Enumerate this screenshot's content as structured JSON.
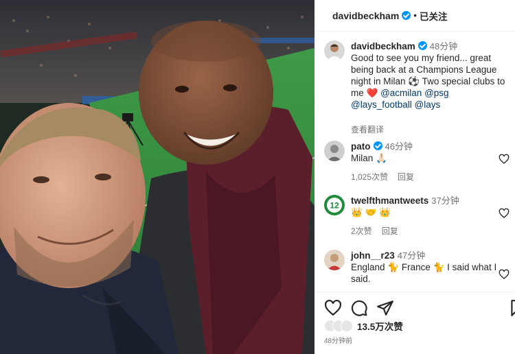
{
  "photo": {
    "alt_icon": "photo-image",
    "colors": {
      "crowd": "#3b3f47",
      "pitch": "#2f8a3e",
      "coat": "#2b2d31",
      "hoodie": "#5a1f2a"
    }
  },
  "header": {
    "username": "davidbeckham",
    "separator": "•",
    "follow_label": "已关注"
  },
  "caption": {
    "username": "davidbeckham",
    "time": "48分钟",
    "text_before": "Good to see you my friend... great being back at a Champions League night in Milan",
    "emoji_ball": "⚽",
    "text_middle": " Two special clubs to me ",
    "emoji_heart": "❤️",
    "tag1": "@acmilan",
    "tag2": "@psg",
    "tag3": "@lays_football",
    "tag4": "@lays",
    "translate": "查看翻译"
  },
  "comments": [
    {
      "username": "pato",
      "verified": true,
      "time": "46分钟",
      "text": "Milan 🙏🏻",
      "likes": "1,025次赞",
      "reply": "回复"
    },
    {
      "username": "twelfthmantweets",
      "verified": false,
      "time": "37分钟",
      "text": "👑 🤝 👑",
      "likes": "2次赞",
      "reply": "回复"
    },
    {
      "username": "john__r23",
      "verified": false,
      "time": "47分钟",
      "text": "England 🐈 France 🐈 I said what I said.",
      "likes": "",
      "reply": ""
    }
  ],
  "actions": {
    "likes": "13.5万次赞",
    "posted": "48分钟前"
  },
  "colors": {
    "link": "#00376b",
    "verified": "#0095f6",
    "muted": "#737373",
    "text": "#262626"
  }
}
